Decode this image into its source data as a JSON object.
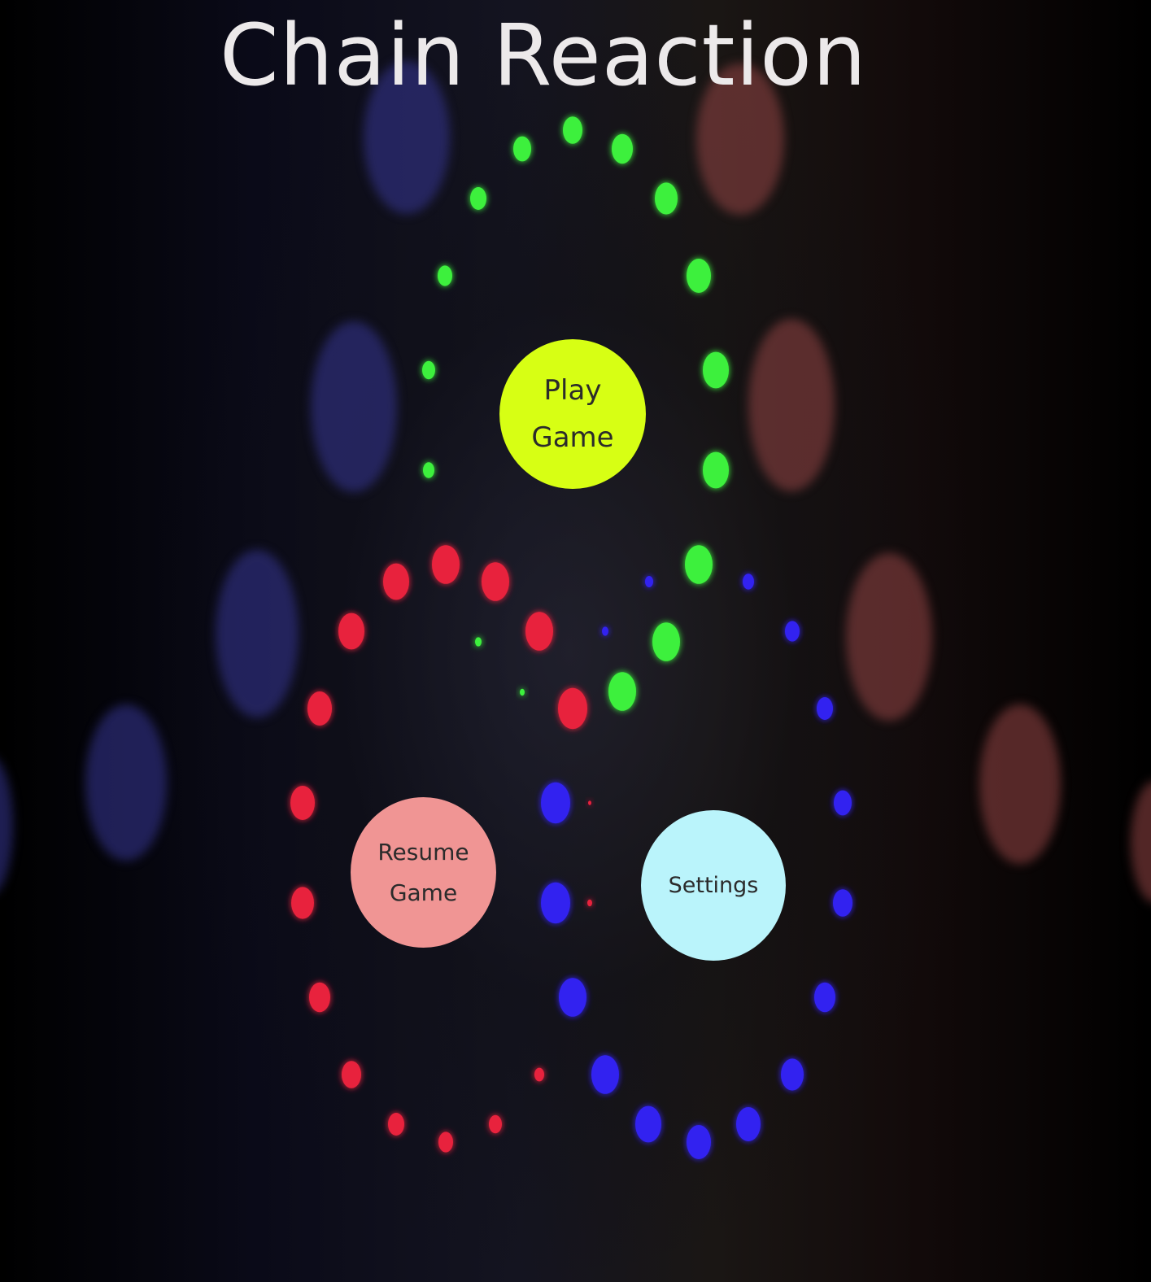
{
  "title": "Chain Reaction",
  "menu": {
    "play_line1": "Play",
    "play_line2": "Game",
    "resume_line1": "Resume",
    "resume_line2": "Game",
    "settings": "Settings"
  },
  "colors": {
    "play": "#d7ff14",
    "resume": "#f09594",
    "settings": "#baf4fb",
    "green_ring": "#3cf03c",
    "red_ring": "#e8203c",
    "blue_ring": "#3020f0"
  }
}
